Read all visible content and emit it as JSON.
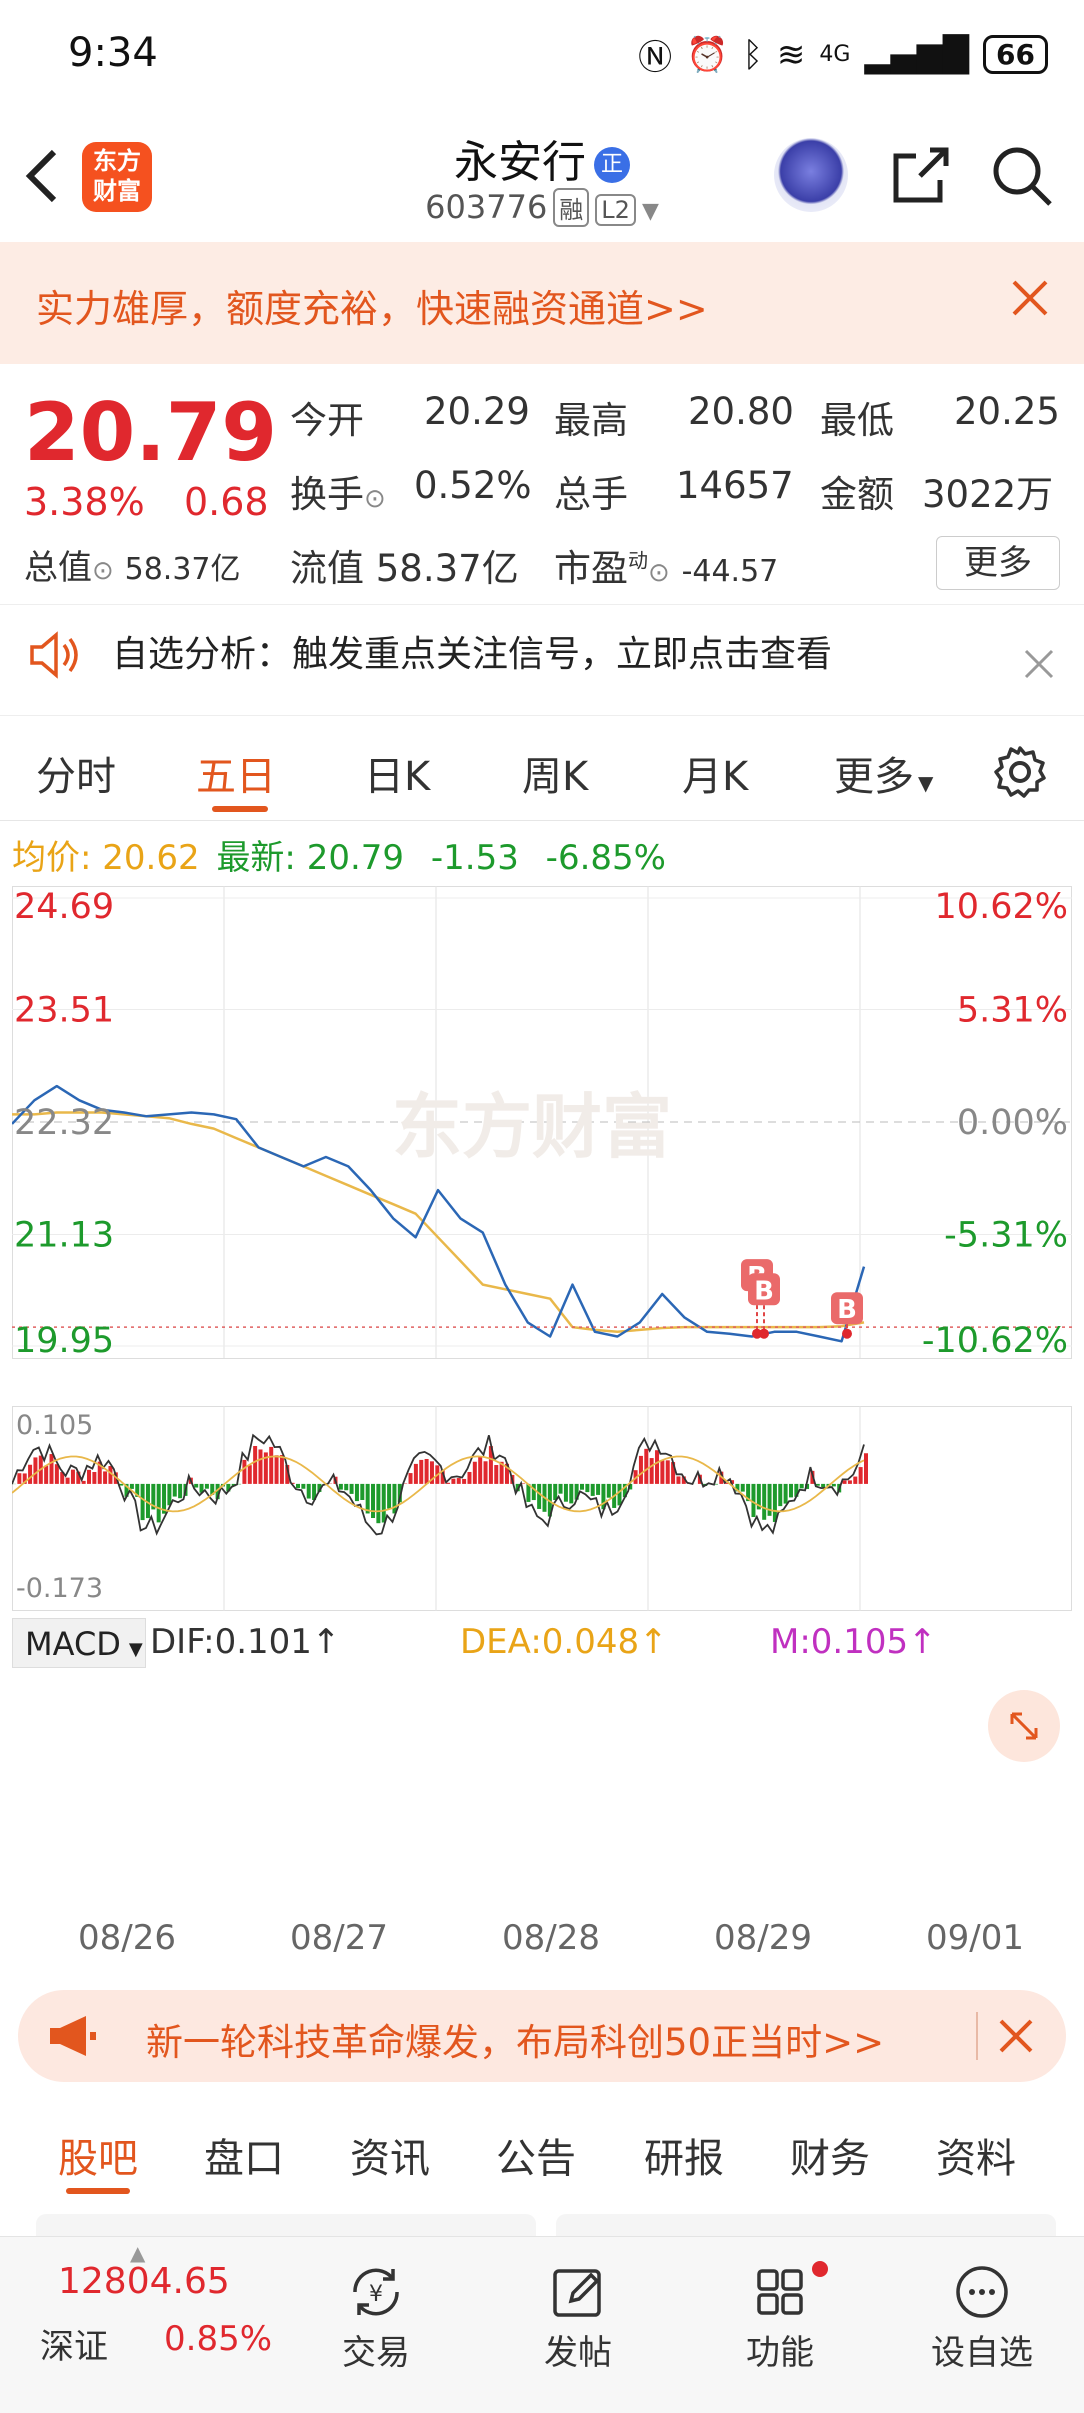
{
  "status_bar": {
    "time": "9:34",
    "signal_text": "4G",
    "battery": "66"
  },
  "header": {
    "logo_text": "东方财富",
    "stock_name": "永安行",
    "name_badge": "正",
    "stock_code": "603776",
    "tag_margin": "融",
    "tag_level": "L2"
  },
  "promo_banner": {
    "text": "实力雄厚，额度充裕，快速融资通道>>"
  },
  "quote": {
    "price": "20.79",
    "change_pct": "3.38%",
    "change": "0.68",
    "open_label": "今开",
    "open": "20.29",
    "high_label": "最高",
    "high": "20.80",
    "low_label": "最低",
    "low": "20.25",
    "turnover_label": "换手",
    "turnover": "0.52%",
    "volume_label": "总手",
    "volume": "14657",
    "amount_label": "金额",
    "amount": "3022万",
    "total_value_label": "总值",
    "total_value": "58.37亿",
    "float_value_label": "流值",
    "float_value": "58.37亿",
    "pe_label": "市盈",
    "pe_sup": "动",
    "pe": "-44.57",
    "more_label": "更多"
  },
  "notify": {
    "text": "自选分析：触发重点关注信号，立即点击查看"
  },
  "period_tabs": [
    "分时",
    "五日",
    "日K",
    "周K",
    "月K",
    "更多"
  ],
  "active_tab": "五日",
  "avg_bar": {
    "avg_label": "均价:",
    "avg": "20.62",
    "latest_label": "最新:",
    "latest": "20.79",
    "change": "-1.53",
    "change_pct": "-6.85%"
  },
  "watermark": "东方财富",
  "indicator": {
    "name": "MACD",
    "dif": "DIF:0.101↑",
    "dea": "DEA:0.048↑",
    "m": "M:0.105↑"
  },
  "chart_data": {
    "type": "line",
    "x_labels": [
      "08/26",
      "08/27",
      "08/28",
      "08/29",
      "09/01"
    ],
    "price_axis": [
      "24.69",
      "23.51",
      "22.32",
      "21.13",
      "19.95"
    ],
    "pct_axis": [
      "10.62%",
      "5.31%",
      "0.00%",
      "-5.31%",
      "-10.62%"
    ],
    "ylim": [
      19.95,
      24.69
    ],
    "prev_close": 22.32,
    "series": [
      {
        "values": [
          22.3,
          22.55,
          22.7,
          22.55,
          22.45,
          22.42,
          22.38,
          22.4,
          22.42,
          22.4,
          22.35,
          22.05,
          21.95,
          21.85,
          21.95,
          21.85,
          21.6,
          21.3,
          21.1,
          21.6,
          21.3,
          21.15,
          20.6,
          20.2,
          20.05,
          20.6,
          20.1,
          20.05,
          20.2,
          20.5,
          20.25,
          20.1,
          20.08,
          20.05,
          20.1,
          20.1,
          20.05,
          20.0,
          20.79
        ]
      },
      {
        "values": [
          22.4,
          22.4,
          22.42,
          22.42,
          22.42,
          22.4,
          22.38,
          22.36,
          22.3,
          22.25,
          22.15,
          22.05,
          21.95,
          21.85,
          21.75,
          21.65,
          21.55,
          21.45,
          21.35,
          21.1,
          20.85,
          20.6,
          20.55,
          20.5,
          20.45,
          20.15,
          20.12,
          20.1,
          20.12,
          20.14,
          20.15,
          20.15,
          20.15,
          20.15,
          20.15,
          20.15,
          20.15,
          20.16,
          20.2
        ]
      }
    ],
    "markers": [
      "B",
      "B",
      "B"
    ],
    "macd_axis": [
      "0.105",
      "-0.173"
    ]
  },
  "banner2": {
    "text": "新一轮科技革命爆发，布局科创50正当时>>"
  },
  "bottom_tabs": [
    "股吧",
    "盘口",
    "资讯",
    "公告",
    "研报",
    "财务",
    "资料"
  ],
  "active_bottom_tab": "股吧",
  "index_ticker": {
    "value": "12804.65",
    "name": "深证",
    "pct": "0.85%"
  },
  "nav": [
    {
      "label": "交易",
      "icon": "yen-cycle-icon"
    },
    {
      "label": "发帖",
      "icon": "edit-icon"
    },
    {
      "label": "功能",
      "icon": "grid-icon"
    },
    {
      "label": "设自选",
      "icon": "more-icon"
    }
  ],
  "colors": {
    "up": "#e0282e",
    "down": "#1d9a2c",
    "accent": "#e2561e",
    "price_line": "#2b67b5",
    "avg_line": "#e9b84a"
  }
}
